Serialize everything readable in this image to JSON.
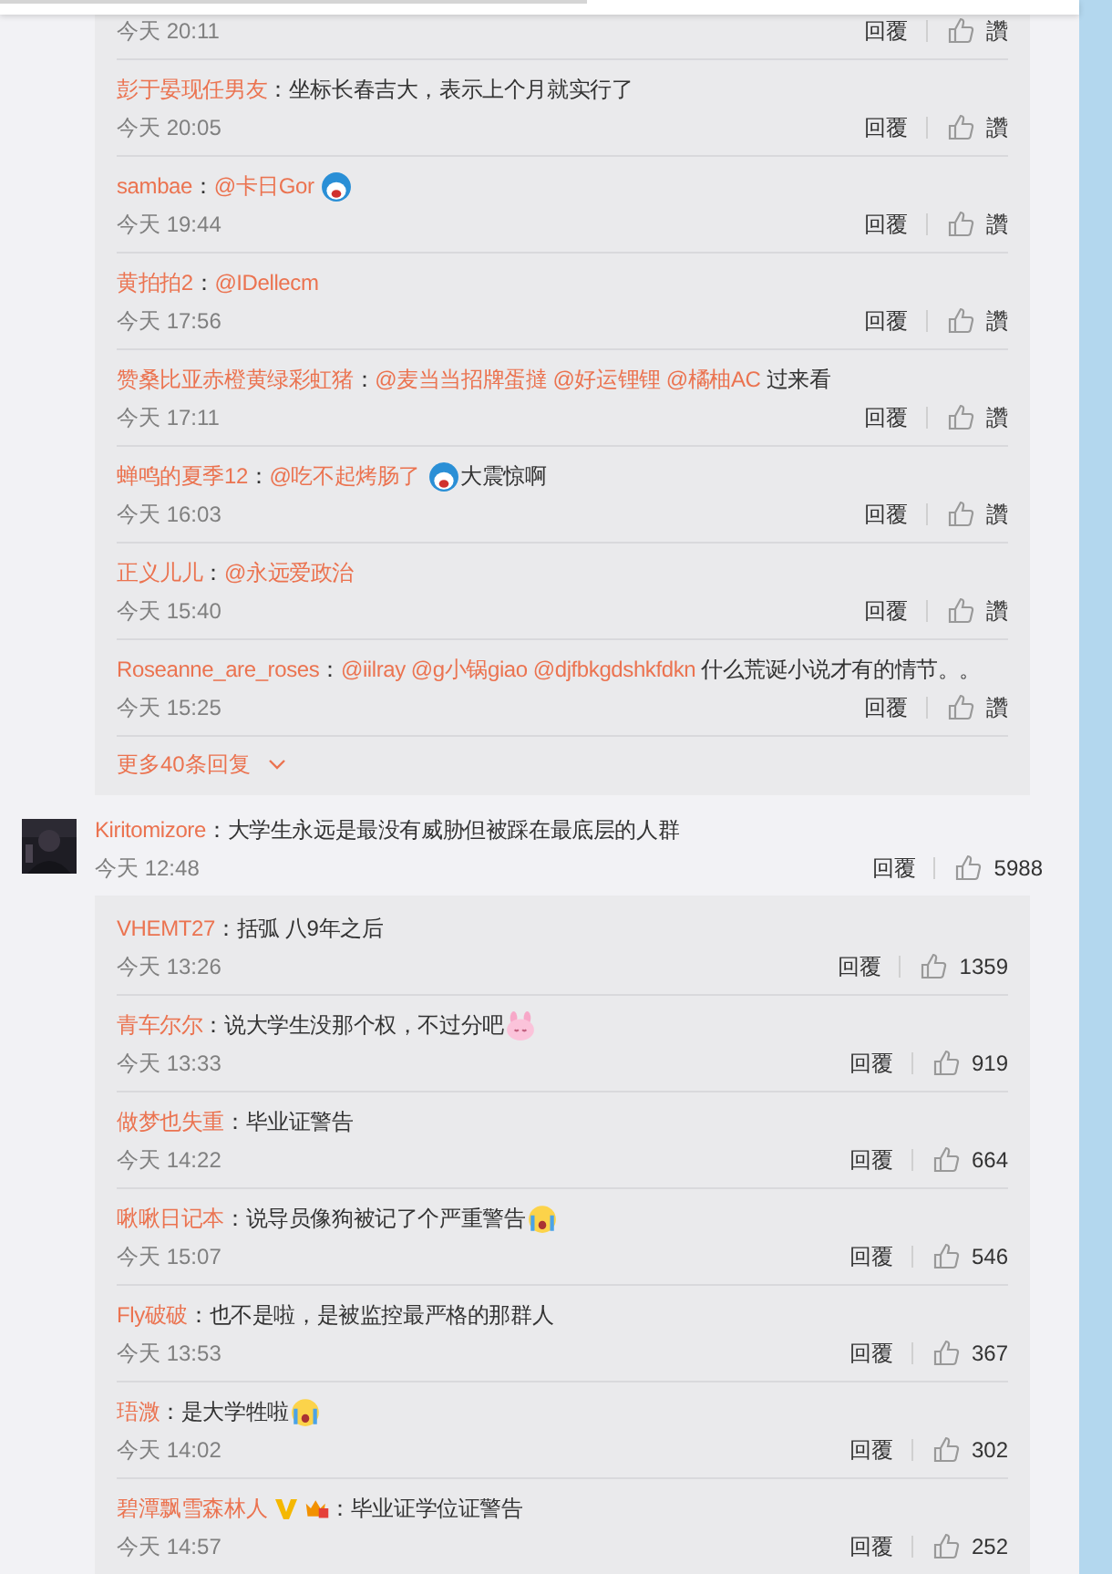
{
  "thread_top": {
    "replies": [
      {
        "time": "今天 20:11",
        "reply": "回覆",
        "likes": "讚"
      },
      {
        "author": "彭于晏现任男友",
        "content": [
          {
            "kind": "text",
            "text": "：坐标长春吉大，表示上个月就实行了"
          }
        ],
        "time": "今天 20:05",
        "reply": "回覆",
        "likes": "讚"
      },
      {
        "author": "sambae",
        "content": [
          {
            "kind": "text",
            "text": "："
          },
          {
            "kind": "mention",
            "text": "@卡日Gor"
          },
          {
            "kind": "emoji_round"
          }
        ],
        "time": "今天 19:44",
        "reply": "回覆",
        "likes": "讚"
      },
      {
        "author": "黄拍拍2",
        "content": [
          {
            "kind": "text",
            "text": "："
          },
          {
            "kind": "mention",
            "text": "@IDellecm"
          }
        ],
        "time": "今天 17:56",
        "reply": "回覆",
        "likes": "讚"
      },
      {
        "author": "赞桑比亚赤橙黄绿彩虹猪",
        "content": [
          {
            "kind": "text",
            "text": "："
          },
          {
            "kind": "mention",
            "text": "@麦当当招牌蛋撻"
          },
          {
            "kind": "mention",
            "text": "@好运锂锂"
          },
          {
            "kind": "mention",
            "text": "@橘柚AC"
          },
          {
            "kind": "text",
            "text": "过来看"
          }
        ],
        "time": "今天 17:11",
        "reply": "回覆",
        "likes": "讚"
      },
      {
        "author": "蝉鸣的夏季12",
        "content": [
          {
            "kind": "text",
            "text": "："
          },
          {
            "kind": "mention",
            "text": "@吃不起烤肠了"
          },
          {
            "kind": "emoji_round"
          },
          {
            "kind": "text",
            "text": "大震惊啊"
          }
        ],
        "time": "今天 16:03",
        "reply": "回覆",
        "likes": "讚"
      },
      {
        "author": "正义儿儿",
        "content": [
          {
            "kind": "text",
            "text": "："
          },
          {
            "kind": "mention",
            "text": "@永远爱政治"
          }
        ],
        "time": "今天 15:40",
        "reply": "回覆",
        "likes": "讚"
      },
      {
        "author": "Roseanne_are_roses",
        "content": [
          {
            "kind": "text",
            "text": "："
          },
          {
            "kind": "mention",
            "text": "@iilray"
          },
          {
            "kind": "mention",
            "text": "@g小锅giao"
          },
          {
            "kind": "mention",
            "text": "@djfbkgdshkfdkn"
          },
          {
            "kind": "text",
            "text": "什么荒诞小说才有的情节。。"
          }
        ],
        "time": "今天 15:25",
        "reply": "回覆",
        "likes": "讚"
      }
    ],
    "more_replies": "更多40条回复"
  },
  "comment": {
    "author": "Kiritomizore",
    "content": [
      {
        "kind": "text",
        "text": "：大学生永远是最没有威胁但被踩在最底层的人群"
      }
    ],
    "time": "今天 12:48",
    "reply": "回覆",
    "likes": "5988",
    "replies": [
      {
        "author": "VHEMT27",
        "content": [
          {
            "kind": "text",
            "text": "：括弧 八9年之后"
          }
        ],
        "time": "今天 13:26",
        "reply": "回覆",
        "likes": "1359"
      },
      {
        "author": "青车尔尔",
        "content": [
          {
            "kind": "text",
            "text": "：说大学生没那个权，不过分吧"
          },
          {
            "kind": "emoji_bunny"
          }
        ],
        "time": "今天 13:33",
        "reply": "回覆",
        "likes": "919"
      },
      {
        "author": "做梦也失重",
        "content": [
          {
            "kind": "text",
            "text": "：毕业证警告"
          }
        ],
        "time": "今天 14:22",
        "reply": "回覆",
        "likes": "664"
      },
      {
        "author": "啾啾日记本",
        "content": [
          {
            "kind": "text",
            "text": "：说导员像狗被记了个严重警告"
          },
          {
            "kind": "emoji_cry"
          }
        ],
        "time": "今天 15:07",
        "reply": "回覆",
        "likes": "546"
      },
      {
        "author": "Fly破破",
        "content": [
          {
            "kind": "text",
            "text": "：也不是啦，是被监控最严格的那群人"
          }
        ],
        "time": "今天 13:53",
        "reply": "回覆",
        "likes": "367"
      },
      {
        "author": "珸溦",
        "content": [
          {
            "kind": "text",
            "text": "：是大学牲啦"
          },
          {
            "kind": "emoji_cry"
          }
        ],
        "time": "今天 14:02",
        "reply": "回覆",
        "likes": "302"
      },
      {
        "author": "碧潭飘雪森林人",
        "badges": [
          {
            "kind": "verified"
          },
          {
            "kind": "member"
          }
        ],
        "content": [
          {
            "kind": "text",
            "text": "：毕业证学位证警告"
          }
        ],
        "time": "今天 14:57",
        "reply": "回覆",
        "likes": "252"
      }
    ]
  }
}
